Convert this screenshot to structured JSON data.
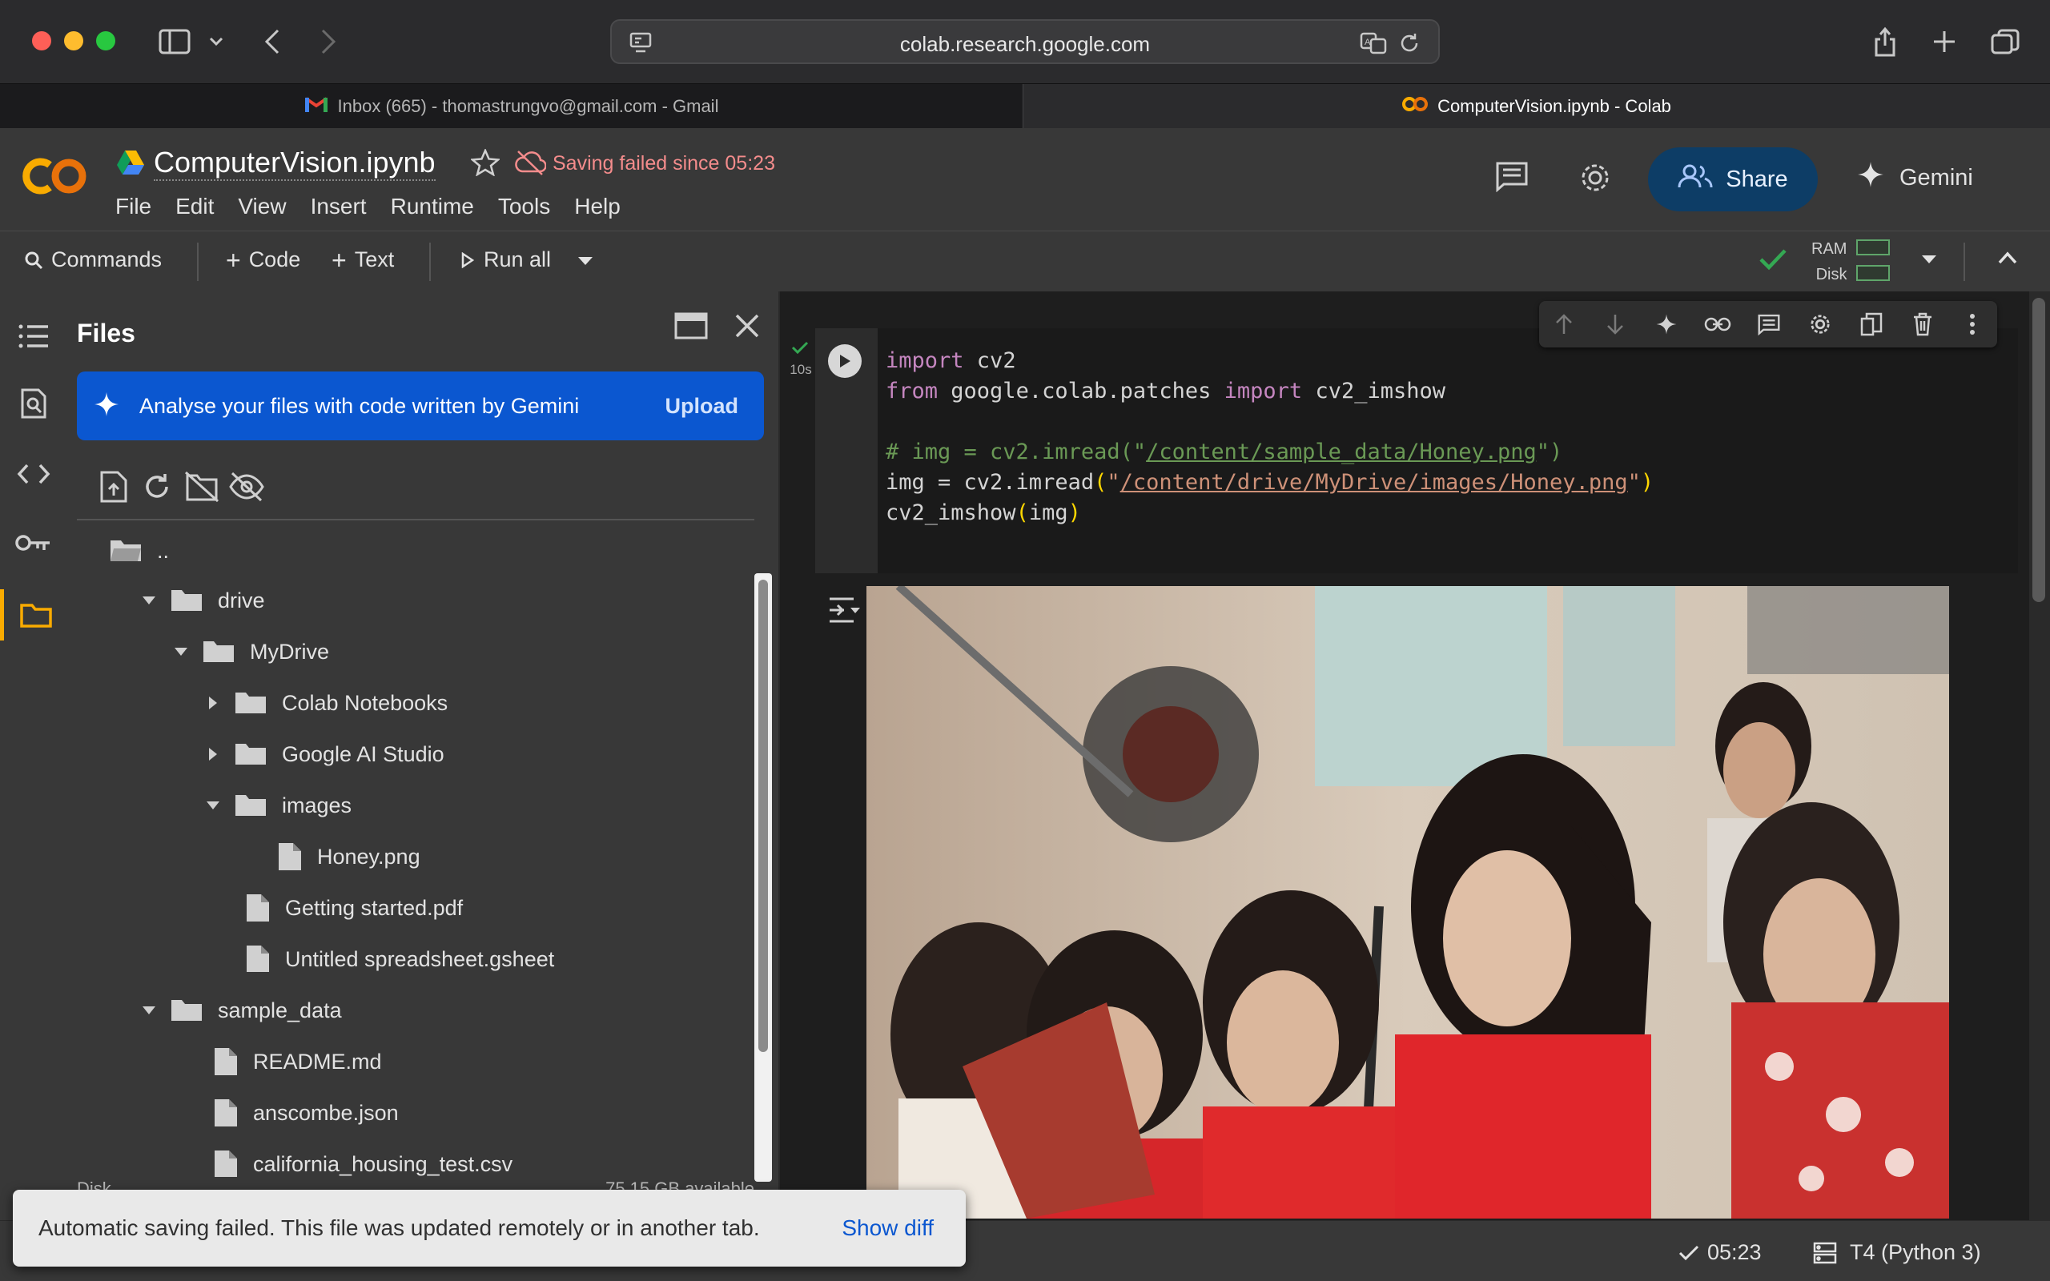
{
  "browser": {
    "url": "colab.research.google.com",
    "tabs": [
      {
        "label": "Inbox (665) - thomastrungvo@gmail.com - Gmail",
        "active": false
      },
      {
        "label": "ComputerVision.ipynb - Colab",
        "active": true
      }
    ]
  },
  "header": {
    "notebook_title": "ComputerVision.ipynb",
    "save_status": "Saving failed since 05:23",
    "menu": [
      "File",
      "Edit",
      "View",
      "Insert",
      "Runtime",
      "Tools",
      "Help"
    ],
    "share_label": "Share",
    "gemini_label": "Gemini"
  },
  "toolbar": {
    "commands_label": "Commands",
    "add_code_label": "Code",
    "add_text_label": "Text",
    "run_all_label": "Run all",
    "ram_label": "RAM",
    "disk_label": "Disk"
  },
  "files_panel": {
    "title": "Files",
    "gemini_banner_text": "Analyse your files with code written by Gemini",
    "upload_label": "Upload",
    "tree": [
      {
        "label": "..",
        "type": "parent"
      },
      {
        "label": "drive",
        "type": "folder",
        "expanded": true
      },
      {
        "label": "MyDrive",
        "type": "folder",
        "expanded": true
      },
      {
        "label": "Colab Notebooks",
        "type": "folder",
        "expanded": false
      },
      {
        "label": "Google AI Studio",
        "type": "folder",
        "expanded": false
      },
      {
        "label": "images",
        "type": "folder",
        "expanded": true
      },
      {
        "label": "Honey.png",
        "type": "file"
      },
      {
        "label": "Getting started.pdf",
        "type": "file"
      },
      {
        "label": "Untitled spreadsheet.gsheet",
        "type": "file"
      },
      {
        "label": "sample_data",
        "type": "folder",
        "expanded": true
      },
      {
        "label": "README.md",
        "type": "file"
      },
      {
        "label": "anscombe.json",
        "type": "file"
      },
      {
        "label": "california_housing_test.csv",
        "type": "file"
      }
    ],
    "disk_label": "Disk",
    "disk_available": "75.15 GB available"
  },
  "cell": {
    "exec_time": "10s",
    "code_lines": [
      "import cv2",
      "from google.colab.patches import cv2_imshow",
      "",
      "# img = cv2.imread(\"/content/sample_data/Honey.png\")",
      "img = cv2.imread(\"/content/drive/MyDrive/images/Honey.png\")",
      "cv2_imshow(img)"
    ]
  },
  "statusbar": {
    "time": "05:23",
    "runtime": "T4 (Python 3)"
  },
  "toast": {
    "message": "Automatic saving failed. This file was updated remotely or in another tab.",
    "action": "Show diff"
  }
}
